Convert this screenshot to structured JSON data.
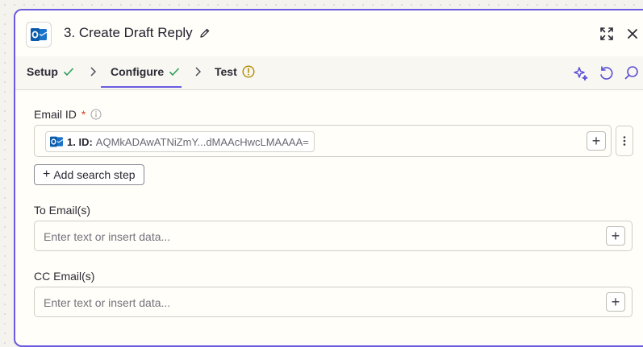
{
  "header": {
    "title": "3. Create Draft Reply",
    "app_icon": "outlook-icon"
  },
  "tabs": [
    {
      "label": "Setup",
      "status": "check"
    },
    {
      "label": "Configure",
      "status": "check",
      "active": true
    },
    {
      "label": "Test",
      "status": "warning"
    }
  ],
  "colors": {
    "accent": "#6a5ae0",
    "check": "#2e9d5b",
    "warning": "#b28a00",
    "required": "#d4422f"
  },
  "fields": {
    "email_id": {
      "label": "Email ID",
      "required_mark": "*",
      "pill_step": "1. ID:",
      "pill_value": "AQMkADAwATNiZmY...dMAAcHwcLMAAAA="
    },
    "add_search_step": "Add search step",
    "to_emails": {
      "label": "To Email(s)",
      "placeholder": "Enter text or insert data..."
    },
    "cc_emails": {
      "label": "CC Email(s)",
      "placeholder": "Enter text or insert data..."
    }
  },
  "plus_symbol": "+"
}
